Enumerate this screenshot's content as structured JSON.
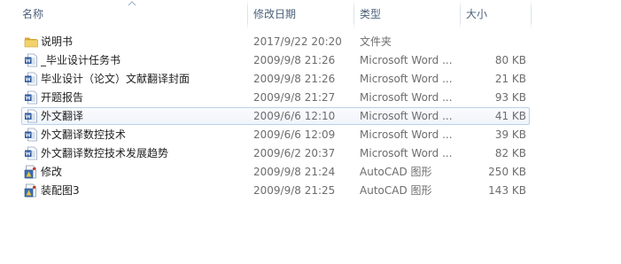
{
  "columns": {
    "name": "名称",
    "date": "修改日期",
    "type": "类型",
    "size": "大小"
  },
  "sort": {
    "column": "name",
    "direction": "ascending",
    "icon": "sort-up-arrow-icon"
  },
  "colors": {
    "header_text": "#4c607a",
    "hover_border": "#b9d1ec",
    "hover_bg": "#f0f5fb",
    "folder": "#e8c34f",
    "word_blue": "#2b579a"
  },
  "files": [
    {
      "name": "说明书",
      "date": "2017/9/22 20:20",
      "type": "文件夹",
      "size": "",
      "icon": "folder-icon"
    },
    {
      "name": "_毕业设计任务书",
      "date": "2009/9/8 21:26",
      "type": "Microsoft Word ...",
      "size": "80 KB",
      "icon": "word-document-icon"
    },
    {
      "name": "毕业设计（论文）文献翻译封面",
      "date": "2009/9/8 21:26",
      "type": "Microsoft Word ...",
      "size": "21 KB",
      "icon": "word-document-icon"
    },
    {
      "name": "开题报告",
      "date": "2009/9/8 21:27",
      "type": "Microsoft Word ...",
      "size": "93 KB",
      "icon": "word-document-icon"
    },
    {
      "name": "外文翻译",
      "date": "2009/6/6 12:10",
      "type": "Microsoft Word ...",
      "size": "41 KB",
      "icon": "word-document-icon",
      "hovered": true
    },
    {
      "name": "外文翻译数控技术",
      "date": "2009/6/6 12:09",
      "type": "Microsoft Word ...",
      "size": "39 KB",
      "icon": "word-document-icon"
    },
    {
      "name": "外文翻译数控技术发展趋势",
      "date": "2009/6/2 20:37",
      "type": "Microsoft Word ...",
      "size": "82 KB",
      "icon": "word-document-icon"
    },
    {
      "name": "修改",
      "date": "2009/9/8 21:24",
      "type": "AutoCAD 图形",
      "size": "250 KB",
      "icon": "autocad-drawing-icon"
    },
    {
      "name": "装配图3",
      "date": "2009/9/8 21:25",
      "type": "AutoCAD 图形",
      "size": "143 KB",
      "icon": "autocad-drawing-icon"
    }
  ]
}
